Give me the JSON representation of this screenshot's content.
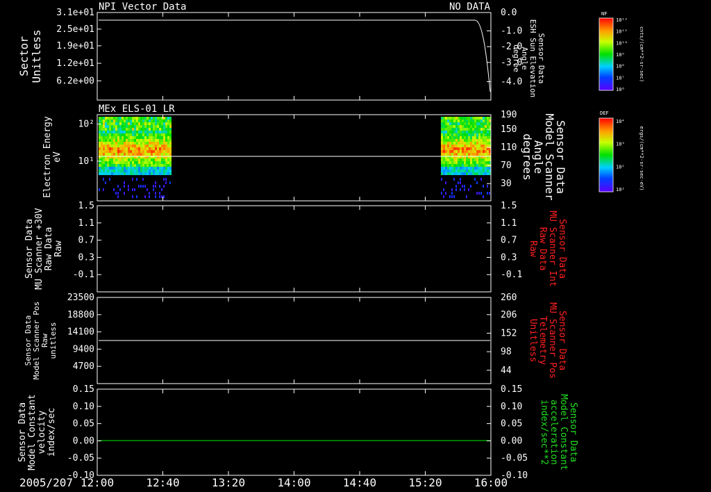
{
  "colors": {
    "frame": "#ffffff",
    "red_label": "#ff2020",
    "green_label": "#20e020",
    "green_line": "#00c000"
  },
  "panel1": {
    "title": "NPI Vector Data",
    "status": "NO DATA",
    "left_label": [
      "Sector",
      "Unitless"
    ],
    "left_ticks": [
      "3.1e+01",
      "2.5e+01",
      "1.9e+01",
      "1.2e+01",
      "6.2e+00"
    ],
    "right_label": [
      "Sensor Data",
      "ESH Sun Elevation",
      "Angle",
      "degree"
    ],
    "right_ticks": [
      "0.0",
      "-1.0",
      "-2.0",
      "-3.0",
      "-4.0"
    ],
    "colorbar_title": "NF",
    "colorbar_unit": "cnts/(cm**2-sr-sec)",
    "colorbar_ticks": [
      "10¹²",
      "10¹¹",
      "10¹⁰",
      "10⁹",
      "10⁸",
      "10⁷",
      "10⁶"
    ]
  },
  "panel2": {
    "title": "MEx ELS-01 LR",
    "left_label": [
      "Electron Energy",
      "eV"
    ],
    "left_ticks": [
      "10²",
      "10¹"
    ],
    "right_label": [
      "Sensor Data",
      "Model Scanner",
      "Angle",
      "degrees"
    ],
    "right_ticks": [
      "190",
      "150",
      "110",
      "70",
      "30"
    ],
    "colorbar_title": "DEF",
    "colorbar_unit": "ergs/(cm**2-sr-sec-eV)",
    "colorbar_ticks": [
      "10⁴",
      "10³",
      "10²",
      "10¹"
    ]
  },
  "panel3": {
    "left_label": [
      "Sensor Data",
      "MU Scanner +30V",
      "Raw Data",
      "Raw"
    ],
    "left_ticks": [
      "1.5",
      "1.1",
      "0.7",
      "0.3",
      "-0.1"
    ],
    "right_label": [
      "Sensor Data",
      "MU Scanner Int",
      "Raw Data",
      "Raw"
    ],
    "right_ticks": [
      "1.5",
      "1.1",
      "0.7",
      "0.3",
      "-0.1"
    ]
  },
  "panel4": {
    "left_label": [
      "Sensor Data",
      "Model Scanner Pos",
      "Raw",
      "unitless"
    ],
    "left_ticks": [
      "23500",
      "18800",
      "14100",
      "9400",
      "4700"
    ],
    "right_label": [
      "Sensor Data",
      "MU Scanner Pos",
      "Telemetry",
      "Unitless"
    ],
    "right_ticks": [
      "260",
      "206",
      "152",
      "98",
      "44"
    ]
  },
  "panel5": {
    "left_label": [
      "Sensor Data",
      "Model Constant",
      "velocity",
      "index/sec"
    ],
    "left_ticks": [
      "0.15",
      "0.10",
      "0.05",
      "0.00",
      "-0.05",
      "-0.10"
    ],
    "right_label": [
      "Sensor Data",
      "Model Constant",
      "acceleration",
      "index/sec**2"
    ],
    "right_ticks": [
      "0.15",
      "0.10",
      "0.05",
      "0.00",
      "-0.05",
      "-0.10"
    ]
  },
  "time_axis": {
    "date": "2005/207",
    "ticks": [
      "12:00",
      "12:40",
      "13:20",
      "14:00",
      "14:40",
      "15:20",
      "16:00"
    ]
  },
  "chart_data": [
    {
      "type": "line",
      "title": "NPI Vector Data",
      "note": "NO DATA",
      "ylabel": "Sector Unitless",
      "y2label": "Sensor Data ESH Sun Elevation Angle degree",
      "x": [
        "12:00",
        "15:50",
        "16:00"
      ],
      "series": [
        {
          "axis": "right",
          "values": [
            -0.2,
            -0.2,
            -4.2
          ]
        }
      ],
      "ylim2": [
        -4.5,
        0.0
      ]
    },
    {
      "type": "heatmap",
      "title": "MEx ELS-01 LR",
      "ylabel": "Electron Energy eV",
      "y2label": "Sensor Data Model Scanner Angle degrees",
      "log_y": true,
      "coverage": [
        [
          "12:00",
          "12:47"
        ],
        [
          "15:24",
          "16:00"
        ]
      ],
      "series": [
        {
          "axis": "right",
          "values": [
            98,
            98
          ]
        }
      ],
      "ylim2": [
        0,
        190
      ]
    },
    {
      "type": "line",
      "ylabel": "Sensor Data MU Scanner +30V Raw Data Raw",
      "y2label": "Sensor Data MU Scanner Int Raw Data Raw",
      "ylim": [
        -0.3,
        1.5
      ],
      "series": []
    },
    {
      "type": "line",
      "ylabel": "Sensor Data Model Scanner Pos Raw unitless",
      "y2label": "Sensor Data MU Scanner Pos Telemetry Unitless",
      "ylim": [
        0,
        23500
      ],
      "series": [
        {
          "values": [
            11300,
            11300
          ]
        }
      ]
    },
    {
      "type": "line",
      "ylabel": "Sensor Data Model Constant velocity index/sec",
      "y2label": "Sensor Data Model Constant acceleration index/sec**2",
      "ylim": [
        -0.1,
        0.15
      ],
      "series": [
        {
          "values": [
            0.0,
            0.0
          ]
        }
      ]
    }
  ]
}
